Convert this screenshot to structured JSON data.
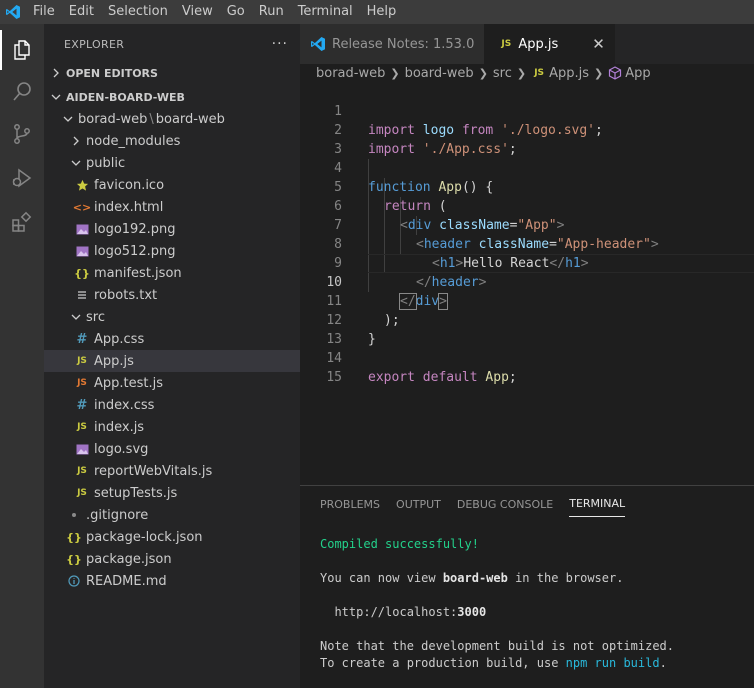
{
  "menu": [
    "File",
    "Edit",
    "Selection",
    "View",
    "Go",
    "Run",
    "Terminal",
    "Help"
  ],
  "colors": {
    "vscode_blue": "#23a9f2",
    "selected_row": "#37373d",
    "activity_bar": "#333333",
    "sidebar": "#252526"
  },
  "explorer": {
    "title": "EXPLORER",
    "more": "···",
    "open_editors": "OPEN EDITORS",
    "workspace": "AIDEN-BOARD-WEB",
    "root_a": "borad-web",
    "root_b": "board-web",
    "node_modules": "node_modules",
    "public": "public",
    "public_files": [
      "favicon.ico",
      "index.html",
      "logo192.png",
      "logo512.png",
      "manifest.json",
      "robots.txt"
    ],
    "src": "src",
    "src_files": [
      "App.css",
      "App.js",
      "App.test.js",
      "index.css",
      "index.js",
      "logo.svg",
      "reportWebVitals.js",
      "setupTests.js"
    ],
    "root_files": [
      ".gitignore",
      "package-lock.json",
      "package.json",
      "README.md"
    ]
  },
  "tabs": [
    {
      "label": "Release Notes: 1.53.0",
      "icon": "vscode-icon"
    },
    {
      "label": "App.js",
      "icon": "js-icon",
      "close": "✕"
    }
  ],
  "breadcrumb": [
    "borad-web",
    "board-web",
    "src",
    "App.js",
    "App"
  ],
  "icons": {
    "js": "JS",
    "css": "#",
    "json": "{}",
    "html": "<>"
  },
  "editor": {
    "line_numbers": [
      "1",
      "2",
      "3",
      "4",
      "5",
      "6",
      "7",
      "8",
      "9",
      "10",
      "11",
      "12",
      "13",
      "14",
      "15"
    ],
    "current_line": 10,
    "code": {
      "l1_import": "import",
      "l1_logo": "logo",
      "l1_from": "from",
      "l1_str": "'./logo.svg'",
      "l1_semi": ";",
      "l2_import": "import",
      "l2_str": "'./App.css'",
      "l2_semi": ";",
      "l4_function": "function",
      "l4_name": "App",
      "l4_rest": "() {",
      "l5_return": "return",
      "l5_rest": "(",
      "l6_open": "<",
      "l6_tag": "div",
      "l6_attr": "className",
      "l6_eq": "=",
      "l6_val": "\"App\"",
      "l6_close": ">",
      "l7_open": "<",
      "l7_tag": "header",
      "l7_attr": "className",
      "l7_eq": "=",
      "l7_val": "\"App-header\"",
      "l7_close": ">",
      "l8_open": "<",
      "l8_tag": "h1",
      "l8_close": ">",
      "l8_text": "Hello React",
      "l8_open2": "</",
      "l8_tag2": "h1",
      "l8_close2": ">",
      "l9_open": "</",
      "l9_tag": "header",
      "l9_close": ">",
      "l10_open": "</",
      "l10_tag": "div",
      "l10_close": ">",
      "l11": ");",
      "l12": "}",
      "l14_export": "export",
      "l14_default": "default",
      "l14_name": "App",
      "l14_semi": ";"
    }
  },
  "panel": {
    "tabs": [
      "PROBLEMS",
      "OUTPUT",
      "DEBUG CONSOLE",
      "TERMINAL"
    ],
    "active_tab": "TERMINAL",
    "terminal": {
      "compiled": "Compiled successfully!",
      "view_pre": "You can now view ",
      "view_app": "board-web",
      "view_post": " in the browser.",
      "url_pre": "  http://localhost:",
      "url_port": "3000",
      "note1": "Note that the development build is not optimized.",
      "note2_pre": "To create a production build, use ",
      "note2_cmd": "npm run build",
      "note2_post": "."
    }
  }
}
